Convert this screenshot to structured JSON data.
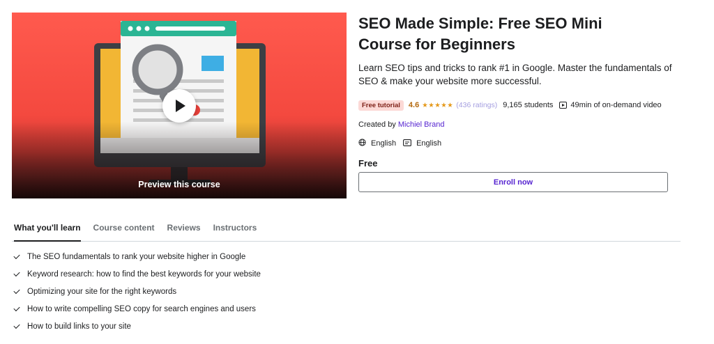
{
  "preview": {
    "label": "Preview this course",
    "icons": [
      "play-icon",
      "magnifier-illustration",
      "monitor-illustration"
    ]
  },
  "course": {
    "title": "SEO Made Simple: Free SEO Mini Course for Beginners",
    "subtitle": "Learn SEO tips and tricks to rank #1 in Google. Master the fundamentals of SEO & make your website more successful.",
    "badge": "Free tutorial",
    "rating": "4.6",
    "stars": "★★★★★",
    "ratings_count": "(436 ratings)",
    "students": "9,165 students",
    "duration": "49min of on-demand video",
    "created_prefix": "Created by",
    "instructor": "Michiel Brand",
    "language": "English",
    "caption_language": "English",
    "price": "Free",
    "enroll_label": "Enroll now"
  },
  "tabs": [
    {
      "label": "What you'll learn",
      "active": true
    },
    {
      "label": "Course content",
      "active": false
    },
    {
      "label": "Reviews",
      "active": false
    },
    {
      "label": "Instructors",
      "active": false
    }
  ],
  "learn_items": [
    "The SEO fundamentals to rank your website higher in Google",
    "Keyword research: how to find the best keywords for your website",
    "Optimizing your site for the right keywords",
    "How to write compelling SEO copy for search engines and users",
    "How to build links to your site"
  ],
  "colors": {
    "accent": "#5624d0",
    "rating": "#b4690e",
    "badge_bg": "#fcd9d6",
    "preview_bg": "#f4493f"
  }
}
